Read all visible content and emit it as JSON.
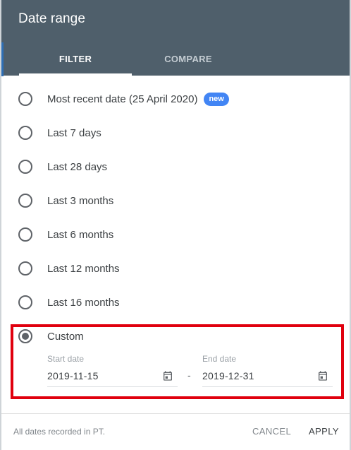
{
  "dialog": {
    "title": "Date range",
    "tabs": [
      {
        "label": "FILTER",
        "active": true
      },
      {
        "label": "COMPARE",
        "active": false
      }
    ]
  },
  "options": [
    {
      "label": "Most recent date (25 April 2020)",
      "badge": "new",
      "selected": false
    },
    {
      "label": "Last 7 days",
      "selected": false
    },
    {
      "label": "Last 28 days",
      "selected": false
    },
    {
      "label": "Last 3 months",
      "selected": false
    },
    {
      "label": "Last 6 months",
      "selected": false
    },
    {
      "label": "Last 12 months",
      "selected": false
    },
    {
      "label": "Last 16 months",
      "selected": false
    },
    {
      "label": "Custom",
      "selected": true
    }
  ],
  "custom": {
    "start_label": "Start date",
    "start_value": "2019-11-15",
    "separator": "-",
    "end_label": "End date",
    "end_value": "2019-12-31",
    "icon": "calendar-icon"
  },
  "footer": {
    "note": "All dates recorded in PT.",
    "cancel_label": "CANCEL",
    "apply_label": "APPLY"
  },
  "colors": {
    "header_bg": "#4f5f6b",
    "badge_bg": "#4285f4",
    "highlight": "#e0000e"
  }
}
